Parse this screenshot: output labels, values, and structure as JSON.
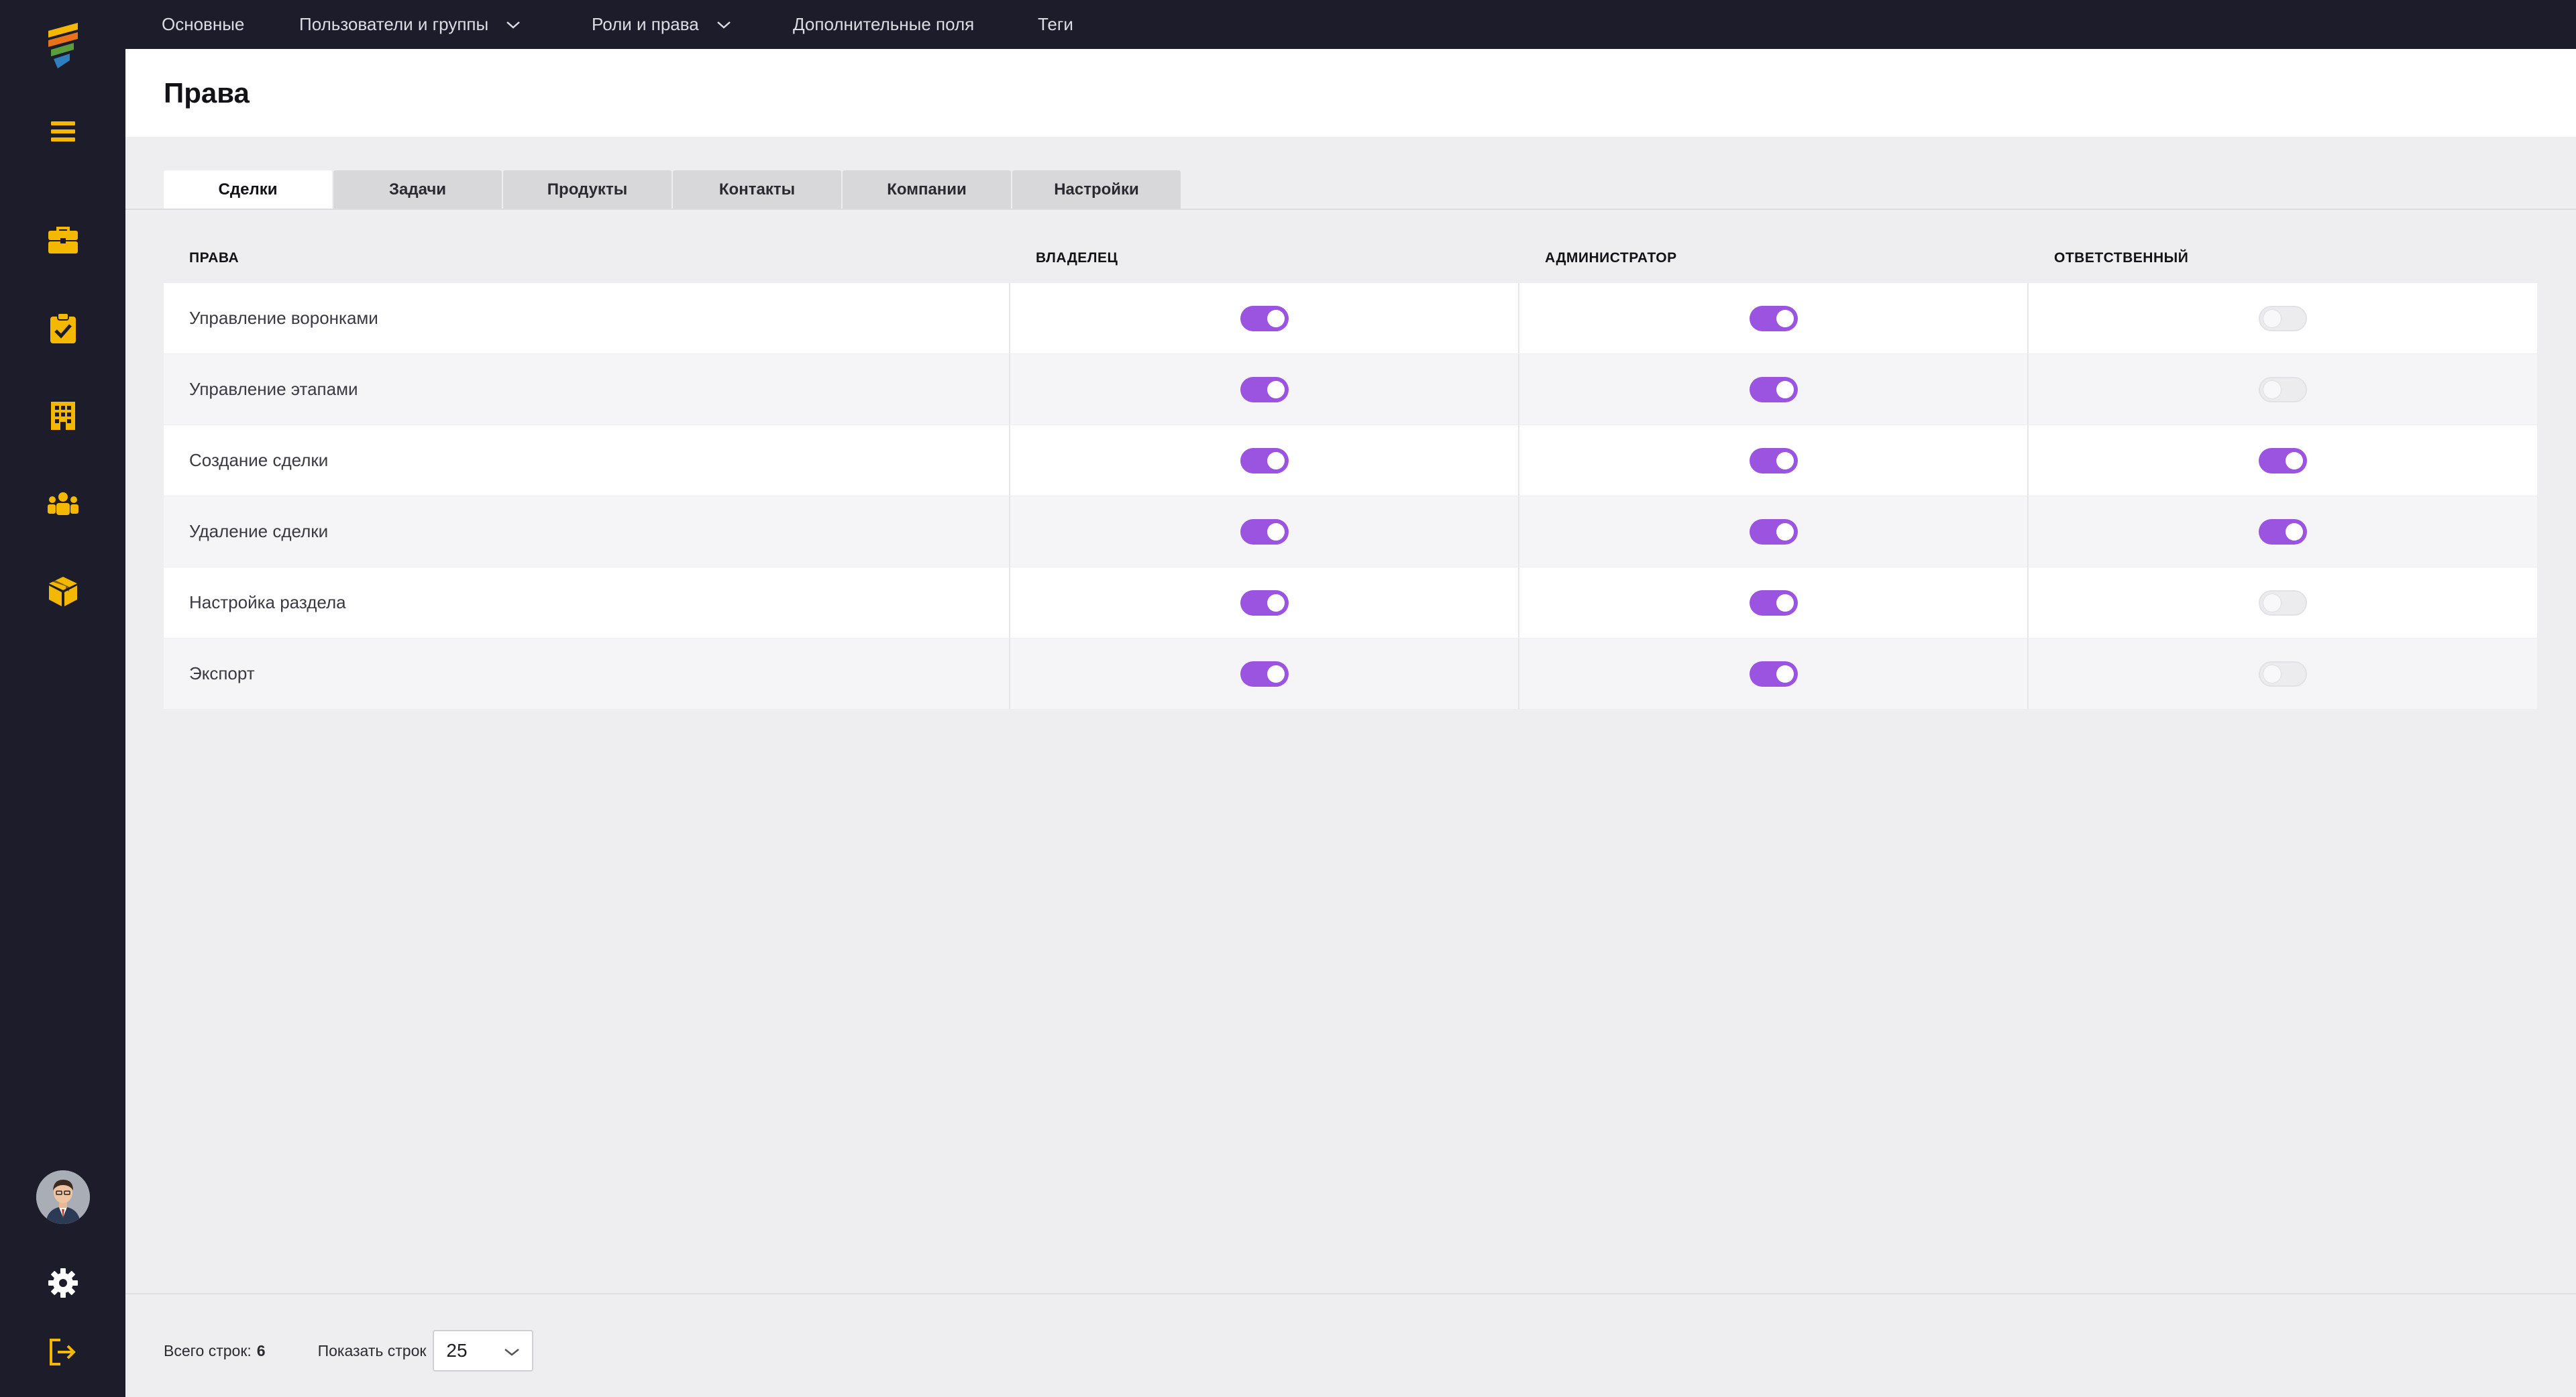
{
  "app": {
    "logo": "brand-logo",
    "accent": "#9a54e0",
    "icon_color": "#f5b800",
    "sidebar_bg": "#1d1c2b"
  },
  "sidebar": {
    "items": [
      {
        "icon": "menu-icon"
      },
      {
        "icon": "briefcase-icon"
      },
      {
        "icon": "clipboard-check-icon"
      },
      {
        "icon": "building-icon"
      },
      {
        "icon": "users-icon"
      },
      {
        "icon": "box-icon"
      }
    ],
    "bottom": [
      {
        "icon": "avatar"
      },
      {
        "icon": "gear-icon"
      },
      {
        "icon": "logout-icon"
      }
    ]
  },
  "topnav": {
    "items": [
      {
        "label": "Основные",
        "has_dropdown": false
      },
      {
        "label": "Пользователи и группы",
        "has_dropdown": true
      },
      {
        "label": "Роли и права",
        "has_dropdown": true
      },
      {
        "label": "Дополнительные поля",
        "has_dropdown": false
      },
      {
        "label": "Теги",
        "has_dropdown": false
      }
    ]
  },
  "page": {
    "title": "Права"
  },
  "tabs": [
    {
      "label": "Сделки",
      "active": true
    },
    {
      "label": "Задачи",
      "active": false
    },
    {
      "label": "Продукты",
      "active": false
    },
    {
      "label": "Контакты",
      "active": false
    },
    {
      "label": "Компании",
      "active": false
    },
    {
      "label": "Настройки",
      "active": false
    }
  ],
  "table": {
    "headers": [
      "ПРАВА",
      "ВЛАДЕЛЕЦ",
      "АДМИНИСТРАТОР",
      "ОТВЕТСТВЕННЫЙ"
    ],
    "rows": [
      {
        "name": "Управление воронками",
        "owner": true,
        "admin": true,
        "responsible": false
      },
      {
        "name": "Управление этапами",
        "owner": true,
        "admin": true,
        "responsible": false
      },
      {
        "name": "Создание сделки",
        "owner": true,
        "admin": true,
        "responsible": true
      },
      {
        "name": "Удаление сделки",
        "owner": true,
        "admin": true,
        "responsible": true
      },
      {
        "name": "Настройка раздела",
        "owner": true,
        "admin": true,
        "responsible": false
      },
      {
        "name": "Экспорт",
        "owner": true,
        "admin": true,
        "responsible": false
      }
    ]
  },
  "footer": {
    "total_label": "Всего строк:",
    "total_value": "6",
    "show_label": "Показать строк",
    "page_size": "25"
  }
}
